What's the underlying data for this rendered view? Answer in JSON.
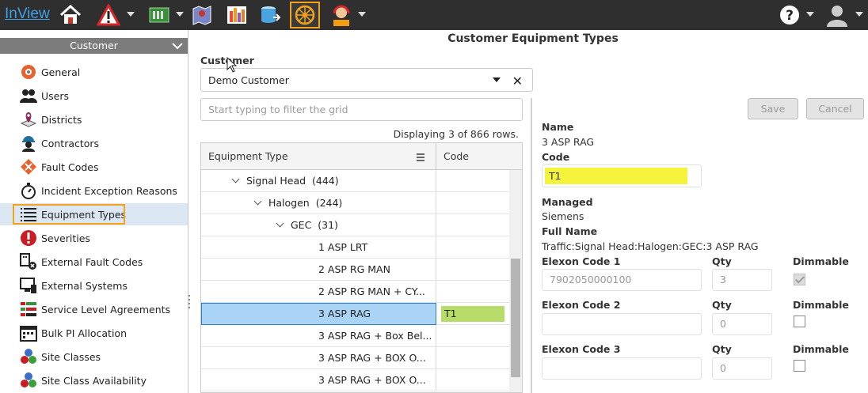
{
  "app": {
    "brand": "InView"
  },
  "sidebar": {
    "section_title": "Customer",
    "items": [
      {
        "label": "General",
        "icon": "gear-icon"
      },
      {
        "label": "Users",
        "icon": "users-icon"
      },
      {
        "label": "Districts",
        "icon": "map-pin-icon"
      },
      {
        "label": "Contractors",
        "icon": "worker-icon"
      },
      {
        "label": "Fault Codes",
        "icon": "fault-code-icon"
      },
      {
        "label": "Incident Exception Reasons",
        "icon": "stopwatch-icon"
      },
      {
        "label": "Equipment Types",
        "icon": "list-icon"
      },
      {
        "label": "Severities",
        "icon": "alert-icon"
      },
      {
        "label": "External Fault Codes",
        "icon": "external-fault-icon"
      },
      {
        "label": "External Systems",
        "icon": "external-system-icon"
      },
      {
        "label": "Service Level Agreements",
        "icon": "sla-icon"
      },
      {
        "label": "Bulk PI Allocation",
        "icon": "calendar-icon"
      },
      {
        "label": "Site Classes",
        "icon": "site-class-icon"
      },
      {
        "label": "Site Class Availability",
        "icon": "site-class-availability-icon"
      }
    ]
  },
  "main": {
    "title": "Customer Equipment Types",
    "customer_label": "Customer",
    "customer_value": "Demo Customer",
    "filter_placeholder": "Start typing to filter the grid",
    "row_count": "Displaying 3 of 866 rows.",
    "grid": {
      "col_type": "Equipment Type",
      "col_code": "Code",
      "rows": [
        {
          "label": "Signal Head",
          "count": "(444)",
          "code": ""
        },
        {
          "label": "Halogen",
          "count": "(244)",
          "code": ""
        },
        {
          "label": "GEC",
          "count": "(31)",
          "code": ""
        },
        {
          "label": "1 ASP LRT",
          "code": ""
        },
        {
          "label": "2 ASP RG MAN",
          "code": ""
        },
        {
          "label": "2 ASP RG MAN + CY...",
          "code": ""
        },
        {
          "label": "3 ASP RAG",
          "code": "T1"
        },
        {
          "label": "3 ASP RAG + Box Bel...",
          "code": ""
        },
        {
          "label": "3 ASP RAG + BOX O...",
          "code": ""
        },
        {
          "label": "3 ASP RAG + BOX O...",
          "code": ""
        }
      ]
    }
  },
  "detail": {
    "save_label": "Save",
    "cancel_label": "Cancel",
    "name_label": "Name",
    "name_value": "3 ASP RAG",
    "code_label": "Code",
    "code_value": "T1",
    "managed_label": "Managed",
    "managed_value": "Siemens",
    "full_name_label": "Full Name",
    "full_name_value": "Traffic:Signal Head:Halogen:GEC:3 ASP RAG",
    "elexon1_label": "Elexon Code 1",
    "elexon1_value": "7902050000100",
    "qty1_value": "3",
    "elexon2_label": "Elexon Code 2",
    "qty2_value": "0",
    "elexon3_label": "Elexon Code 3",
    "qty3_value": "0",
    "qty_label": "Qty",
    "dimmable_label": "Dimmable",
    "dimmable_values": [
      true,
      false,
      false
    ]
  },
  "colors": {
    "accent_outline": "#f2a31b",
    "selected_row": "#aad4f5",
    "code_highlight": "#b8dc6a",
    "field_highlight": "#f6f33c"
  }
}
